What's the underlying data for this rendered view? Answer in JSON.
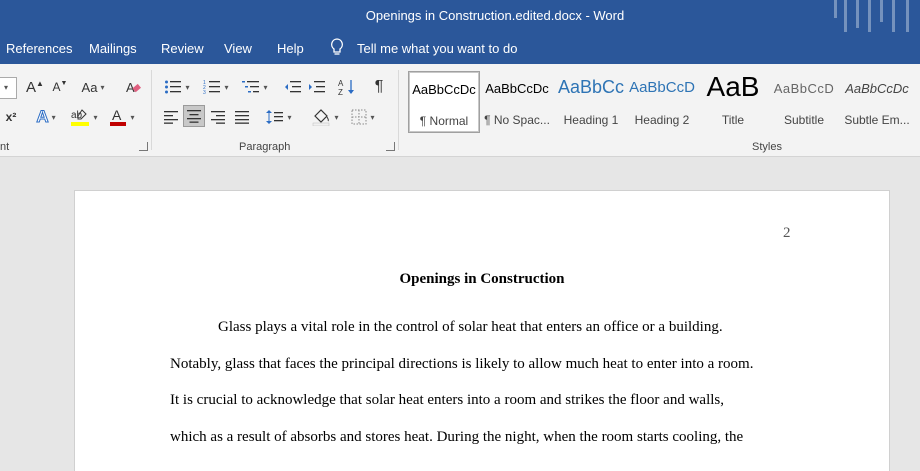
{
  "window": {
    "title": "Openings in Construction.edited.docx  -  Word"
  },
  "menu": {
    "references": "References",
    "mailings": "Mailings",
    "review": "Review",
    "view": "View",
    "help": "Help",
    "tell_me": "Tell me what you want to do"
  },
  "ribbon": {
    "font_group_label": "nt",
    "paragraph_group_label": "Paragraph",
    "styles_group_label": "Styles",
    "grow_font": "A",
    "shrink_font": "A",
    "change_case": "Aa",
    "superscript": "x²",
    "font_color_letter": "A",
    "text_effects": "A"
  },
  "styles": [
    {
      "preview": "AaBbCcDc",
      "name": "¶ Normal"
    },
    {
      "preview": "AaBbCcDc",
      "name": "¶ No Spac..."
    },
    {
      "preview": "AaBbCc",
      "name": "Heading 1"
    },
    {
      "preview": "AaBbCcD",
      "name": "Heading 2"
    },
    {
      "preview": "AaB",
      "name": "Title"
    },
    {
      "preview": "AaBbCcD",
      "name": "Subtitle"
    },
    {
      "preview": "AaBbCcDc",
      "name": "Subtle Em..."
    }
  ],
  "document": {
    "page_number": "2",
    "heading": "Openings in Construction",
    "lines": [
      "Glass plays a vital role in the control of solar heat that enters an office or a building.",
      "Notably, glass that faces the principal directions is likely to allow much heat to enter into a room.",
      "It is crucial to acknowledge that solar heat enters into a room and strikes the floor and walls,",
      "which as a result of absorbs and stores heat. During the night, when the room starts cooling, the"
    ]
  },
  "colors": {
    "accent": "#2b579a",
    "font_color_bar": "#c00000",
    "highlight_bar": "#ffff00"
  }
}
